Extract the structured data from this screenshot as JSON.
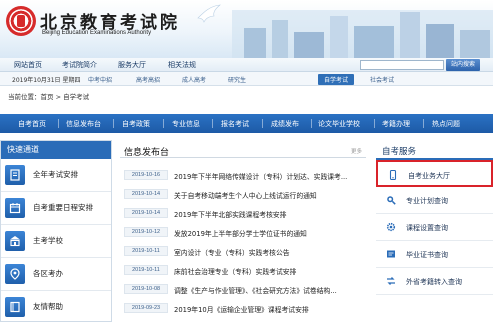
{
  "banner": {
    "title": "北京教育考试院",
    "subtitle": "Beijing Education Examinations Authority"
  },
  "topnav": {
    "items": [
      "网站首页",
      "考试院简介",
      "服务大厅",
      "相关法规"
    ],
    "search_button": "站内搜索"
  },
  "daterow": {
    "date": "2019年10月31日 星期四",
    "items": [
      "中考中招",
      "高考高招",
      "成人高考",
      "研究生",
      "自学考试",
      "社会考试"
    ],
    "active_index": 4
  },
  "breadcrumb": "当前位置：首页 > 自学考试",
  "mainnav": {
    "items": [
      "自考首页",
      "信息发布台",
      "自考政策",
      "专业信息",
      "报名考试",
      "成绩发布",
      "论文毕业学校",
      "考籍办理",
      "热点问题"
    ]
  },
  "quick": {
    "title": "快速通道",
    "items": [
      {
        "label": "全年考试安排",
        "icon": "document-icon"
      },
      {
        "label": "自考重要日程安排",
        "icon": "calendar-icon"
      },
      {
        "label": "主考学校",
        "icon": "school-icon"
      },
      {
        "label": "各区考办",
        "icon": "location-icon"
      },
      {
        "label": "友情帮助",
        "icon": "help-book-icon"
      }
    ]
  },
  "news": {
    "title": "信息发布台",
    "more": "更多",
    "rows": [
      {
        "date": "2019-10-16",
        "title": "2019年下半年网络传媒设计（专科）计划达、实践课考..."
      },
      {
        "date": "2019-10-14",
        "title": "关于自考移动端考生个人中心上线试运行的通知"
      },
      {
        "date": "2019-10-14",
        "title": "2019年下半年北部实践课程考核安排"
      },
      {
        "date": "2019-10-12",
        "title": "发放2019年上半年部分学士学位证书的通知"
      },
      {
        "date": "2019-10-11",
        "title": "室内设计（专业（专科）实践考核公告"
      },
      {
        "date": "2019-10-11",
        "title": "床前社会治理专业（专科）实践考试安排"
      },
      {
        "date": "2019-10-08",
        "title": "调整《生产与作业管理》、《社会研究方法》试卷结构..."
      },
      {
        "date": "2019-09-23",
        "title": "2019年10月《运输企业管理》课程考试安排"
      }
    ]
  },
  "services": {
    "title": "自考服务",
    "items": [
      {
        "label": "自考业务大厅",
        "icon": "phone-icon",
        "highlight": true
      },
      {
        "label": "专业计划查询",
        "icon": "search-icon",
        "highlight": false
      },
      {
        "label": "课程设置查询",
        "icon": "gear-icon",
        "highlight": false
      },
      {
        "label": "毕业证书查询",
        "icon": "certificate-icon",
        "highlight": false
      },
      {
        "label": "外省考籍转入查询",
        "icon": "transfer-icon",
        "highlight": false
      }
    ]
  },
  "colors": {
    "nav_blue": "#1d5aa6",
    "quick_head": "#2a6cb8",
    "highlight_red": "#d9232a"
  }
}
